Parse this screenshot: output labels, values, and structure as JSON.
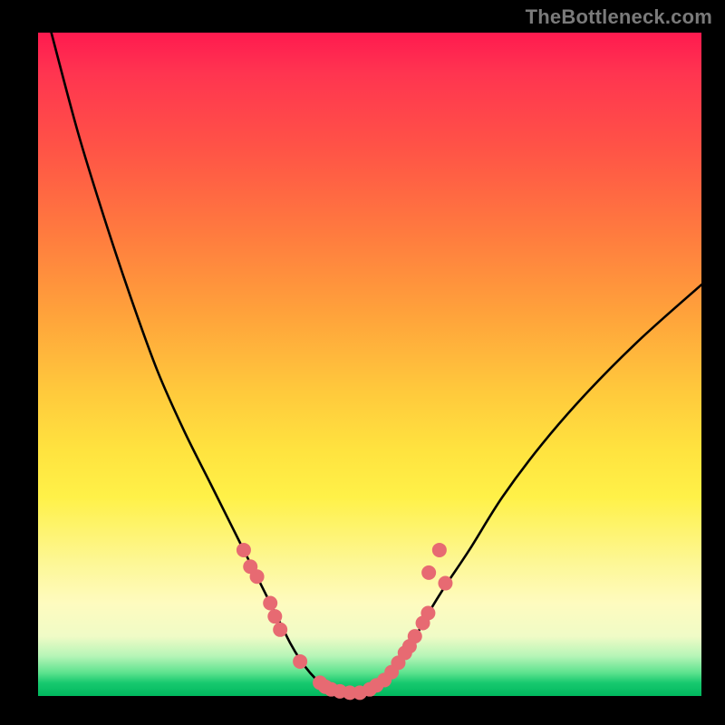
{
  "watermark": "TheBottleneck.com",
  "chart_data": {
    "type": "line",
    "title": "",
    "xlabel": "",
    "ylabel": "",
    "xlim": [
      0,
      100
    ],
    "ylim": [
      0,
      100
    ],
    "grid": false,
    "legend": false,
    "series": [
      {
        "name": "bottleneck-curve",
        "x": [
          2,
          6,
          10,
          14,
          18,
          22,
          26,
          29,
          31,
          33,
          35,
          36.5,
          38,
          39.5,
          41,
          42.5,
          44,
          46,
          48,
          50,
          52,
          54,
          56,
          58,
          61,
          65,
          70,
          76,
          83,
          91,
          100
        ],
        "y": [
          100,
          85,
          72,
          60,
          49,
          40,
          32,
          26,
          22,
          18,
          14,
          11,
          8,
          5.5,
          3.5,
          2,
          1,
          0.5,
          0.5,
          1,
          2,
          4,
          7,
          11,
          16,
          22,
          30,
          38,
          46,
          54,
          62
        ]
      }
    ],
    "markers": {
      "name": "highlighted-points",
      "color": "#e76a72",
      "radius_px": 8,
      "points": [
        {
          "x": 31,
          "y": 22
        },
        {
          "x": 32,
          "y": 19.5
        },
        {
          "x": 33,
          "y": 18
        },
        {
          "x": 35,
          "y": 14
        },
        {
          "x": 35.7,
          "y": 12
        },
        {
          "x": 36.5,
          "y": 10
        },
        {
          "x": 39.5,
          "y": 5.2
        },
        {
          "x": 42.5,
          "y": 2
        },
        {
          "x": 43.3,
          "y": 1.4
        },
        {
          "x": 44.2,
          "y": 1
        },
        {
          "x": 45.5,
          "y": 0.7
        },
        {
          "x": 47,
          "y": 0.5
        },
        {
          "x": 48.5,
          "y": 0.5
        },
        {
          "x": 50,
          "y": 1
        },
        {
          "x": 51,
          "y": 1.6
        },
        {
          "x": 52.2,
          "y": 2.4
        },
        {
          "x": 53.3,
          "y": 3.6
        },
        {
          "x": 54.3,
          "y": 5
        },
        {
          "x": 55.3,
          "y": 6.5
        },
        {
          "x": 56,
          "y": 7.5
        },
        {
          "x": 56.8,
          "y": 9
        },
        {
          "x": 58,
          "y": 11
        },
        {
          "x": 58.8,
          "y": 12.5
        },
        {
          "x": 61.4,
          "y": 17
        },
        {
          "x": 60.5,
          "y": 22
        },
        {
          "x": 58.9,
          "y": 18.6
        }
      ]
    }
  }
}
